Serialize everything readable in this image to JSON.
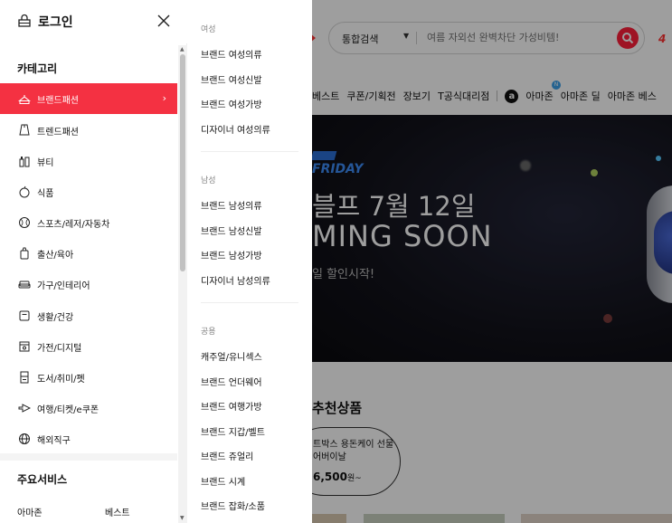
{
  "background": {
    "search": {
      "type_label": "통합검색",
      "placeholder": "여름 자외선 완벽차단 가성비템!"
    },
    "edge_text": "4",
    "gnb": [
      "베스트",
      "쿠폰/기획전",
      "장보기",
      "T공식대리점",
      "아마존",
      "아마존 딜",
      "아마존 베스"
    ],
    "amazon_logo_letter": "a",
    "new_badge": "N",
    "banner": {
      "friday": "FRIDAY",
      "title": "블프 7월 12일",
      "soon": "MING SOON",
      "sub": "일 할인시작!"
    },
    "reco": {
      "title": "추천상품",
      "name": "트박스 용돈케이 선물 어버이날",
      "price": "6,500",
      "unit": "원~"
    }
  },
  "drawer": {
    "login_label": "로그인",
    "category_heading": "카테고리",
    "categories": [
      {
        "label": "브랜드패션",
        "icon": "hanger-icon",
        "active": true
      },
      {
        "label": "트렌드패션",
        "icon": "clothes-icon",
        "active": false
      },
      {
        "label": "뷰티",
        "icon": "cosmetics-icon",
        "active": false
      },
      {
        "label": "식품",
        "icon": "apple-icon",
        "active": false
      },
      {
        "label": "스포츠/레저/자동차",
        "icon": "ball-icon",
        "active": false
      },
      {
        "label": "출산/육아",
        "icon": "baby-bottle-icon",
        "active": false
      },
      {
        "label": "가구/인테리어",
        "icon": "sofa-icon",
        "active": false
      },
      {
        "label": "생활/건강",
        "icon": "box-icon",
        "active": false
      },
      {
        "label": "가전/디지털",
        "icon": "tv-icon",
        "active": false
      },
      {
        "label": "도서/취미/펫",
        "icon": "book-icon",
        "active": false
      },
      {
        "label": "여행/티켓/e쿠폰",
        "icon": "ticket-icon",
        "active": false
      },
      {
        "label": "해외직구",
        "icon": "globe-icon",
        "active": false
      }
    ],
    "services_heading": "주요서비스",
    "services": [
      "아마존",
      "베스트"
    ]
  },
  "submenu": {
    "groups": [
      {
        "label": "여성",
        "items": [
          "브랜드 여성의류",
          "브랜드 여성신발",
          "브랜드 여성가방",
          "디자이너 여성의류"
        ]
      },
      {
        "label": "남성",
        "items": [
          "브랜드 남성의류",
          "브랜드 남성신발",
          "브랜드 남성가방",
          "디자이너 남성의류"
        ]
      },
      {
        "label": "공용",
        "items": [
          "캐주얼/유니섹스",
          "브랜드 언더웨어",
          "브랜드 여행가방",
          "브랜드 지갑/벨트",
          "브랜드 쥬얼리",
          "브랜드 시계",
          "브랜드 잡화/소품"
        ]
      }
    ]
  },
  "colors": {
    "accent": "#f43142",
    "search_button": "#ff1f3a"
  }
}
